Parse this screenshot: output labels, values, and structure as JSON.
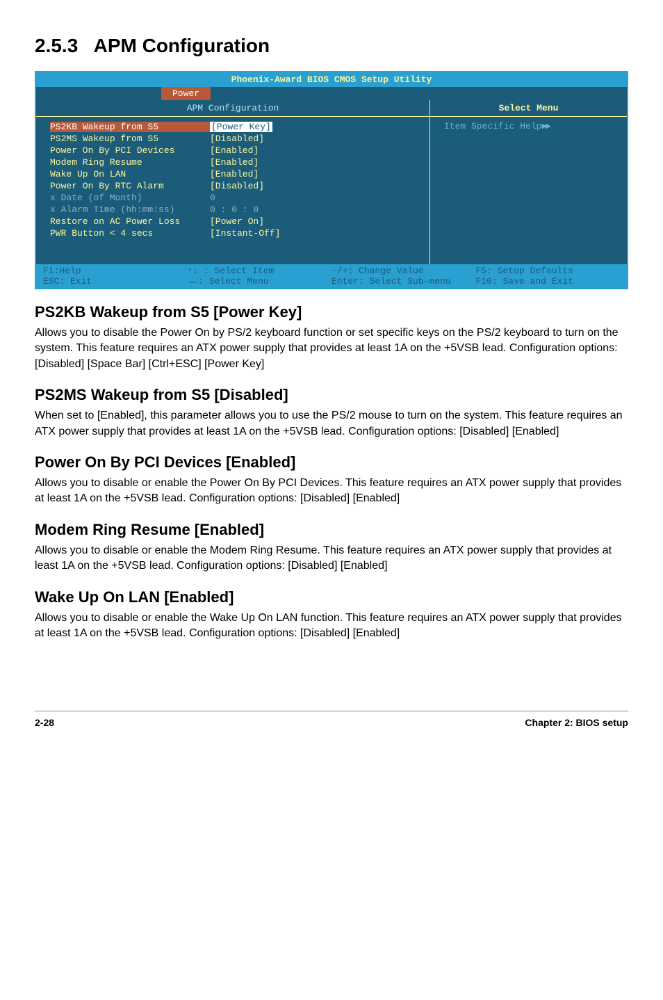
{
  "section": {
    "number": "2.5.3",
    "title": "APM Configuration"
  },
  "bios": {
    "title": "Phoenix-Award BIOS CMOS Setup Utility",
    "tab": "Power",
    "left_header": "APM Configuration",
    "right_header": "Select Menu",
    "help_text": "Item Specific Help",
    "rows": [
      {
        "label": "PS2KB Wakeup from S5",
        "value": "[Power Key]",
        "highlighted": true
      },
      {
        "label": "PS2MS Wakeup from S5",
        "value": "[Disabled]"
      },
      {
        "label": "Power On By PCI Devices",
        "value": "[Enabled]"
      },
      {
        "label": "Modem Ring Resume",
        "value": "[Enabled]"
      },
      {
        "label": "Wake Up On LAN",
        "value": "[Enabled]"
      },
      {
        "label": "Power On By RTC Alarm",
        "value": "[Disabled]"
      },
      {
        "label": "Date (of Month)",
        "value": "  0",
        "prefix": "x",
        "dimmed": true
      },
      {
        "label": "Alarm Time (hh:mm:ss)",
        "value": " 0 : 0 : 0",
        "prefix": "x",
        "dimmed": true
      },
      {
        "label": "Restore on AC Power Loss",
        "value": "[Power On]"
      },
      {
        "label": "PWR Button < 4 secs",
        "value": "[Instant-Off]"
      }
    ],
    "footer": {
      "col1a": "F1:Help",
      "col1b": "ESC: Exit",
      "col2a": "↑↓ : Select Item",
      "col2b": "→←: Select Menu",
      "col3a": "-/+: Change Value",
      "col3b": "Enter: Select Sub-menu",
      "col4a": "F5: Setup Defaults",
      "col4b": "F10: Save and Exit"
    }
  },
  "subsections": [
    {
      "title": "PS2KB Wakeup from S5 [Power Key]",
      "body": "Allows you to disable the Power On by PS/2 keyboard function or set specific keys on the PS/2 keyboard to turn on the system. This feature requires an ATX power supply that provides at least 1A on the +5VSB lead. Configuration options: [Disabled] [Space Bar] [Ctrl+ESC] [Power Key]"
    },
    {
      "title": "PS2MS Wakeup from S5 [Disabled]",
      "body": "When set to [Enabled], this parameter allows you to use the PS/2 mouse to turn on the system. This feature requires an ATX power supply that provides at least 1A on the +5VSB lead. Configuration options: [Disabled] [Enabled]"
    },
    {
      "title": "Power On By PCI Devices [Enabled]",
      "body": "Allows you to disable or enable the Power On By PCI Devices. This feature requires an ATX power supply that provides at least 1A on the +5VSB lead.  Configuration options: [Disabled] [Enabled]"
    },
    {
      "title": "Modem Ring Resume [Enabled]",
      "body": "Allows you to disable or enable the Modem Ring Resume. This feature requires an ATX power supply that provides at least 1A on the +5VSB lead.  Configuration options: [Disabled] [Enabled]"
    },
    {
      "title": "Wake Up On LAN [Enabled]",
      "body": "Allows you to disable or enable the Wake Up On LAN function. This feature requires an ATX power supply that provides at least 1A on the +5VSB lead.  Configuration options: [Disabled] [Enabled]"
    }
  ],
  "footer": {
    "left": "2-28",
    "right": "Chapter 2: BIOS setup"
  }
}
